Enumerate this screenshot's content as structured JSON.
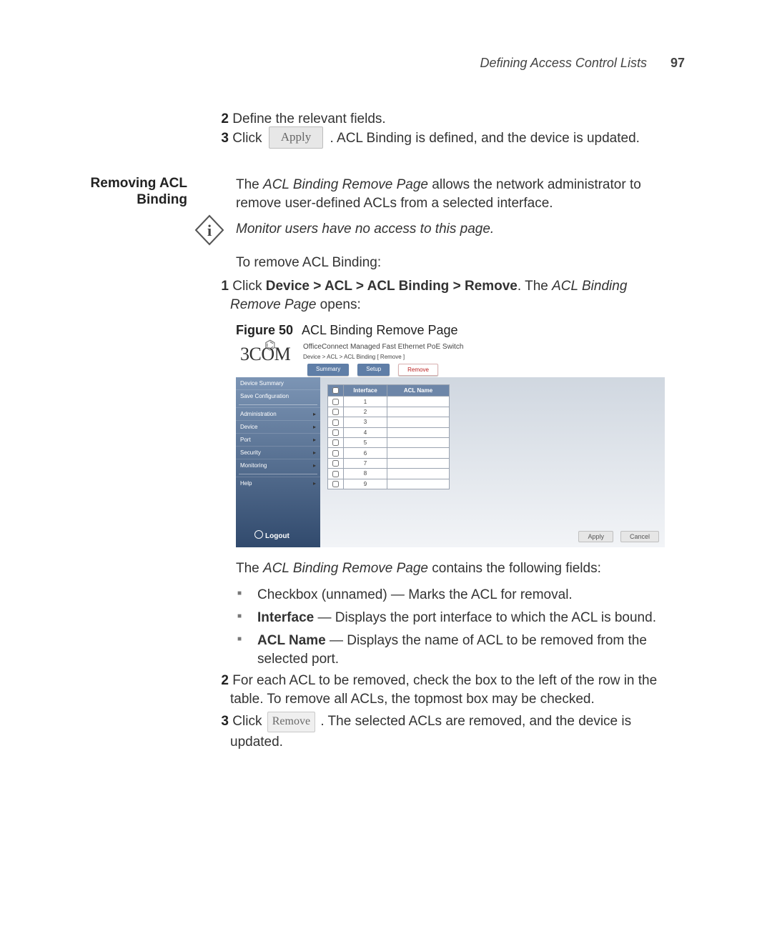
{
  "header": {
    "section_title": "Defining Access Control Lists",
    "page_number": "97"
  },
  "intro_steps": {
    "step2_num": "2",
    "step2_text": "Define the relevant fields.",
    "step3_num": "3",
    "step3_pre": "Click",
    "apply_label": "Apply",
    "step3_post": ". ACL Binding is defined, and the device is updated."
  },
  "section": {
    "side_heading_line1": "Removing ACL",
    "side_heading_line2": "Binding",
    "para1_a": "The ",
    "para1_em": "ACL Binding Remove Page",
    "para1_b": " allows the network administrator to remove user-defined ACLs from a selected interface.",
    "note": "Monitor users have no access to this page.",
    "para2": "To remove ACL Binding:",
    "s1_num": "1",
    "s1_a": "Click ",
    "s1_bold": "Device > ACL > ACL Binding > Remove",
    "s1_b": ". The ",
    "s1_em": "ACL Binding Remove Page",
    "s1_c": " opens:"
  },
  "figure": {
    "label": "Figure 50",
    "caption": "ACL Binding Remove Page"
  },
  "shot": {
    "logo": "3COM",
    "product": "OfficeConnect Managed Fast Ethernet PoE Switch",
    "breadcrumb": "Device > ACL > ACL Binding [ Remove ]",
    "tabs": {
      "summary": "Summary",
      "setup": "Setup",
      "remove": "Remove"
    },
    "sidebar": {
      "device_summary": "Device Summary",
      "save_config": "Save Configuration",
      "admin": "Administration",
      "device": "Device",
      "port": "Port",
      "security": "Security",
      "monitoring": "Monitoring",
      "help": "Help"
    },
    "logout": "Logout",
    "table": {
      "col_interface": "Interface",
      "col_aclname": "ACL Name",
      "rows": [
        {
          "idx": "1",
          "name": ""
        },
        {
          "idx": "2",
          "name": ""
        },
        {
          "idx": "3",
          "name": ""
        },
        {
          "idx": "4",
          "name": ""
        },
        {
          "idx": "5",
          "name": ""
        },
        {
          "idx": "6",
          "name": ""
        },
        {
          "idx": "7",
          "name": ""
        },
        {
          "idx": "8",
          "name": ""
        },
        {
          "idx": "9",
          "name": ""
        }
      ]
    },
    "buttons": {
      "apply": "Apply",
      "cancel": "Cancel"
    }
  },
  "fields": {
    "intro_a": "The ",
    "intro_em": "ACL Binding Remove Page",
    "intro_b": " contains the following fields:",
    "b1": "Checkbox (unnamed) — Marks the ACL for removal.",
    "b2_term": "Interface",
    "b2_rest": " — Displays the port interface to which the ACL is bound.",
    "b3_term": "ACL Name",
    "b3_rest": " — Displays the name of ACL to be removed from the selected port."
  },
  "end_steps": {
    "s2_num": "2",
    "s2_text": "For each ACL to be removed, check the box to the left of the row in the table. To remove all ACLs, the topmost box may be checked.",
    "s3_num": "3",
    "s3_pre": "Click",
    "remove_label": "Remove",
    "s3_post": ". The selected ACLs are removed, and the device is updated."
  }
}
